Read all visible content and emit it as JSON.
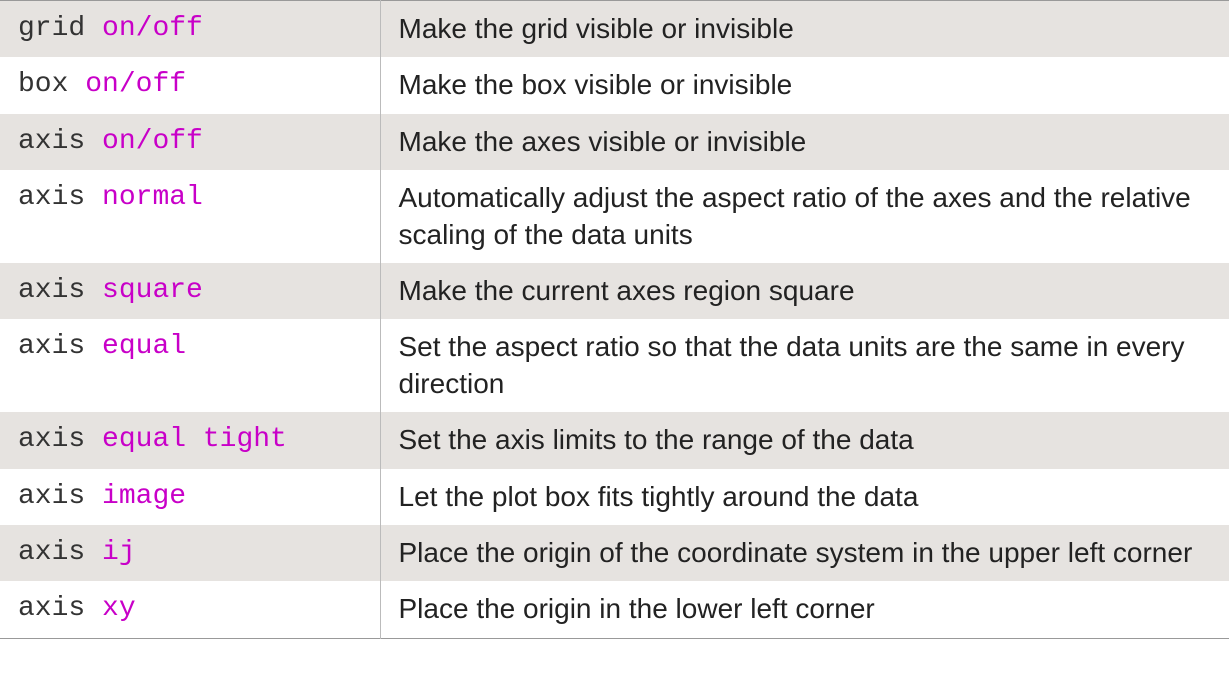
{
  "rows": [
    {
      "cmd_base": "grid",
      "cmd_arg": "on/off",
      "desc": "Make the grid visible or invisible"
    },
    {
      "cmd_base": "box",
      "cmd_arg": "on/off",
      "desc": "Make the box visible or invisible"
    },
    {
      "cmd_base": "axis",
      "cmd_arg": "on/off",
      "desc": "Make the axes visible or invisible"
    },
    {
      "cmd_base": "axis",
      "cmd_arg": "normal",
      "desc": "Automatically adjust the aspect ratio of the axes and the relative scaling of the data units"
    },
    {
      "cmd_base": "axis",
      "cmd_arg": "square",
      "desc": "Make the current axes region square"
    },
    {
      "cmd_base": "axis",
      "cmd_arg": "equal",
      "desc": "Set the aspect ratio so that the data units are the same in every direction"
    },
    {
      "cmd_base": "axis",
      "cmd_arg": "equal tight",
      "desc": "Set the axis limits to the range of the data"
    },
    {
      "cmd_base": "axis",
      "cmd_arg": "image",
      "desc": "Let the plot box fits tightly around the data"
    },
    {
      "cmd_base": "axis",
      "cmd_arg": "ij",
      "desc": "Place the origin of the coordinate system in the upper left corner"
    },
    {
      "cmd_base": "axis",
      "cmd_arg": "xy",
      "desc": "Place the origin in the lower left corner"
    }
  ]
}
